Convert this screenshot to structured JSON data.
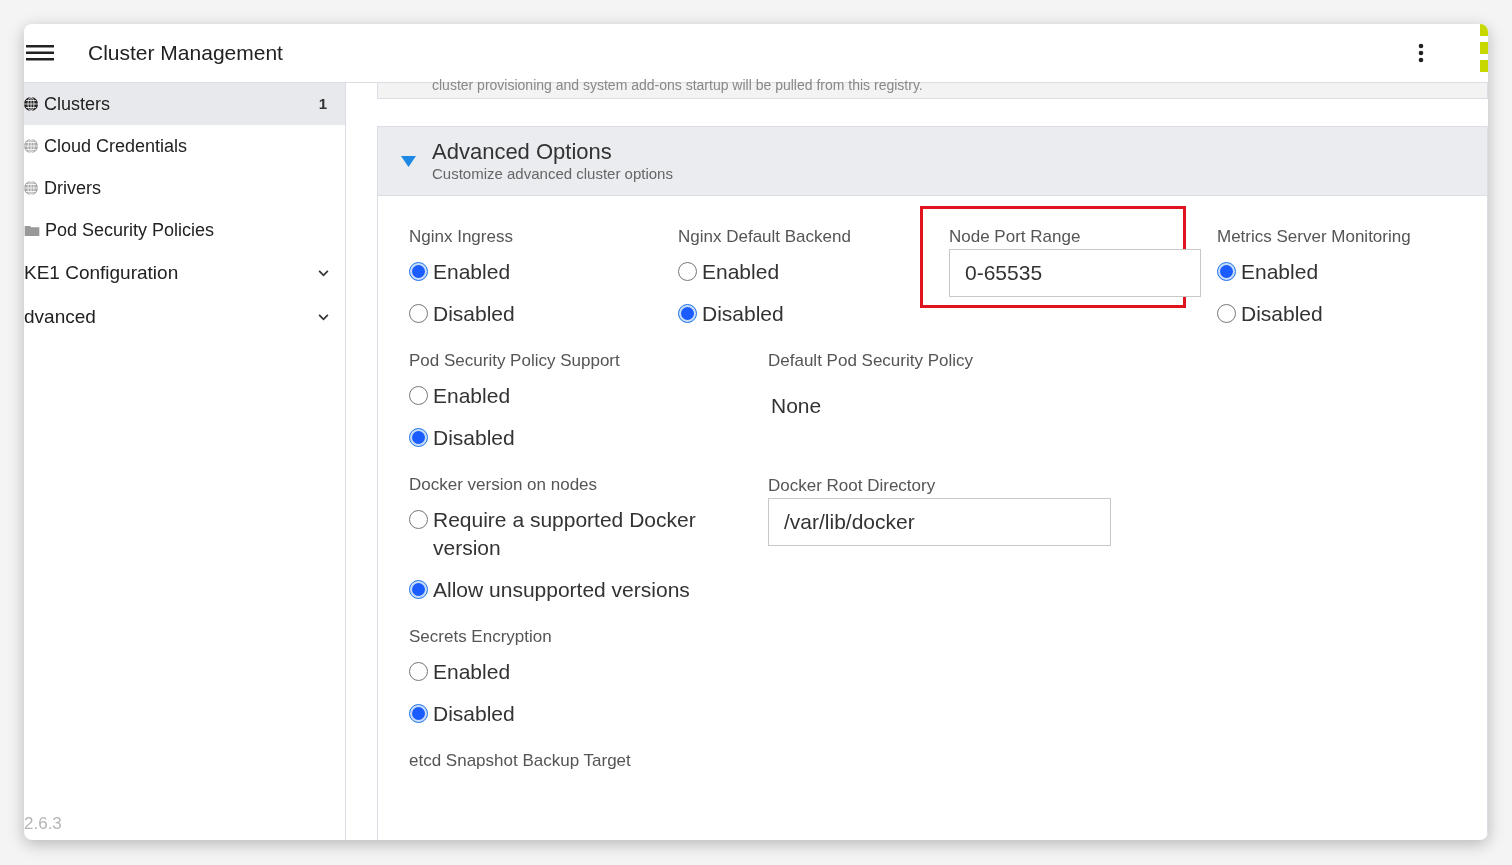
{
  "header": {
    "title": "Cluster Management"
  },
  "sidebar": {
    "items": [
      {
        "kind": "nav",
        "label": "Clusters",
        "count": "1",
        "selected": true
      },
      {
        "kind": "nav",
        "label": "Cloud Credentials",
        "selected": false
      },
      {
        "kind": "nav",
        "label": "Drivers",
        "selected": false
      },
      {
        "kind": "nav",
        "label": "Pod Security Policies",
        "selected": false
      },
      {
        "kind": "group",
        "label": "KE1 Configuration",
        "expanded": false
      },
      {
        "kind": "group",
        "label": "dvanced",
        "expanded": false
      }
    ],
    "version": "2.6.3"
  },
  "registry_note": "cluster provisioning and system add-ons startup will be pulled from this registry.",
  "advanced": {
    "title": "Advanced Options",
    "subtitle": "Customize advanced cluster options",
    "expanded": true,
    "rows": [
      {
        "fields": [
          {
            "kind": "radio",
            "label": "Nginx Ingress",
            "options": [
              {
                "label": "Enabled",
                "selected": true
              },
              {
                "label": "Disabled",
                "selected": false
              }
            ]
          },
          {
            "kind": "radio",
            "label": "Nginx Default Backend",
            "options": [
              {
                "label": "Enabled",
                "selected": false
              },
              {
                "label": "Disabled",
                "selected": true
              }
            ]
          },
          {
            "kind": "text",
            "label": "Node Port Range",
            "value": "0-65535",
            "highlighted": true
          },
          {
            "kind": "radio",
            "label": "Metrics Server Monitoring",
            "options": [
              {
                "label": "Enabled",
                "selected": true
              },
              {
                "label": "Disabled",
                "selected": false
              }
            ]
          }
        ]
      },
      {
        "fields": [
          {
            "kind": "radio",
            "label": "Pod Security Policy Support",
            "options": [
              {
                "label": "Enabled",
                "selected": false
              },
              {
                "label": "Disabled",
                "selected": true
              }
            ]
          },
          {
            "kind": "static",
            "label": "Default Pod Security Policy",
            "value": "None"
          }
        ]
      },
      {
        "fields": [
          {
            "kind": "radio",
            "label": "Docker version on nodes",
            "options": [
              {
                "label": "Require a supported Docker version",
                "selected": false
              },
              {
                "label": "Allow unsupported versions",
                "selected": true
              }
            ]
          },
          {
            "kind": "text",
            "label": "Docker Root Directory",
            "value": "/var/lib/docker",
            "highlighted": false
          }
        ]
      },
      {
        "fields": [
          {
            "kind": "radio",
            "label": "Secrets Encryption",
            "options": [
              {
                "label": "Enabled",
                "selected": false
              },
              {
                "label": "Disabled",
                "selected": true
              }
            ]
          }
        ]
      },
      {
        "fields": [
          {
            "kind": "label",
            "label": "etcd Snapshot Backup Target"
          }
        ]
      }
    ]
  }
}
